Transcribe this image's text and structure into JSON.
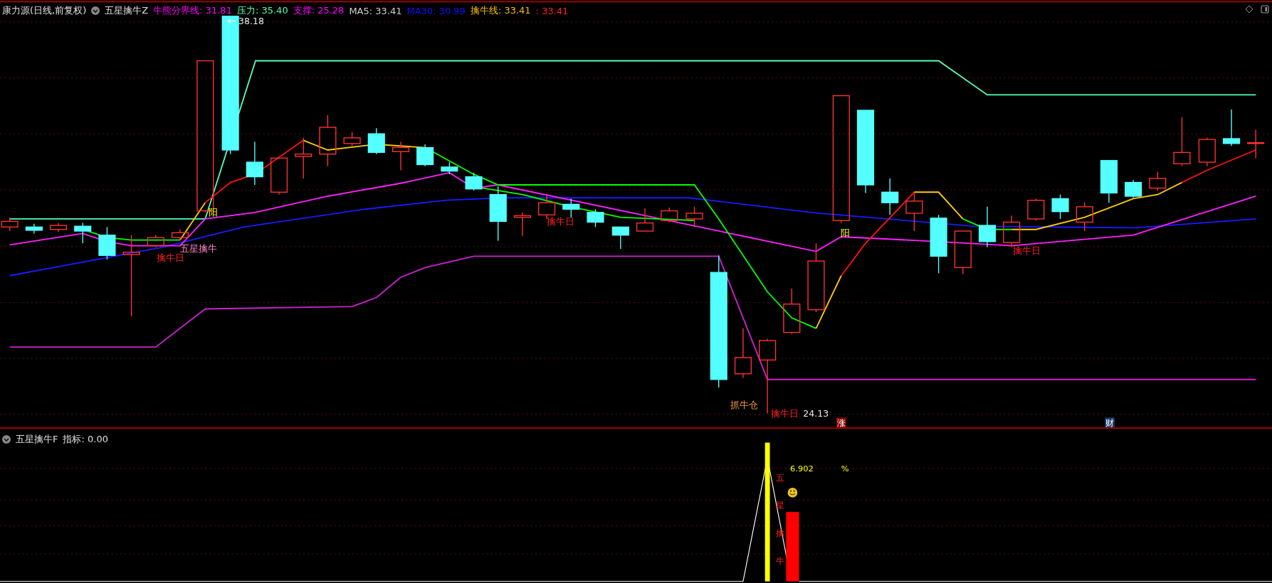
{
  "main_header": {
    "source": "康力源(日线,前复权)",
    "indicator": "五星擒牛Z",
    "values": [
      {
        "label": "牛熊分界线: 31.81",
        "color": "#ff00ff"
      },
      {
        "label": "压力: 35.40",
        "color": "#54ffb4"
      },
      {
        "label": "支撑: 25.28",
        "color": "#ff00ff"
      },
      {
        "label": "MA5: 33.41",
        "color": "#d0d0d0"
      },
      {
        "label": "MA30: 30.99",
        "color": "#1010ff"
      },
      {
        "label": "擒牛线: 33.41",
        "color": "#ffbf00"
      },
      {
        "label": ": 33.41",
        "color": "#ff2020"
      }
    ]
  },
  "chart_labels": [
    {
      "text": "38.18",
      "kind": "price"
    },
    {
      "text": "阳",
      "kind": "yang"
    },
    {
      "text": "五星擒牛",
      "kind": "entry"
    },
    {
      "text": "擒牛日",
      "kind": "signal"
    },
    {
      "text": "擒牛日",
      "kind": "signal"
    },
    {
      "text": "抓牛仓",
      "kind": "buy"
    },
    {
      "text": "擒牛日",
      "kind": "signal"
    },
    {
      "text": "阳",
      "kind": "yang"
    },
    {
      "text": "擒牛日",
      "kind": "signal"
    },
    {
      "text": "24.13",
      "kind": "price"
    }
  ],
  "badges": [
    {
      "text": "涨",
      "color": "#8b0000"
    },
    {
      "text": "财",
      "color": "#1c3d6e"
    }
  ],
  "sub_header": {
    "indicator": "五星擒牛F",
    "value": "指标: 0.00"
  },
  "sub_chart": {
    "vertical_text": "五星擒牛",
    "reading": "6.902",
    "unit": "%"
  }
}
